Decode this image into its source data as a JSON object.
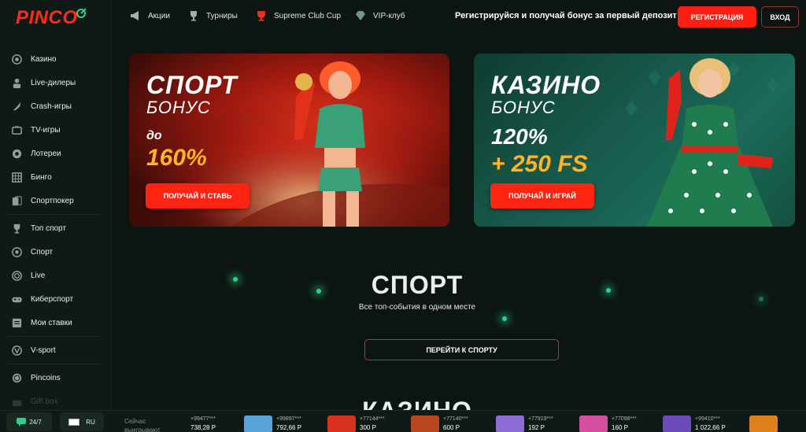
{
  "brand": {
    "name": "PINCO",
    "accent": "#ff2a1a"
  },
  "sidebar": {
    "items": [
      {
        "label": "Казино",
        "icon": "casino-chip-icon"
      },
      {
        "label": "Live-дилеры",
        "icon": "dealer-icon"
      },
      {
        "label": "Crash-игры",
        "icon": "rocket-icon"
      },
      {
        "label": "TV-игры",
        "icon": "tv-icon"
      },
      {
        "label": "Лотереи",
        "icon": "lottery-ball-icon"
      },
      {
        "label": "Бинго",
        "icon": "bingo-icon"
      },
      {
        "label": "Спортпокер",
        "icon": "cards-icon"
      },
      {
        "label": "Топ спорт",
        "icon": "trophy-icon"
      },
      {
        "label": "Спорт",
        "icon": "soccer-ball-icon"
      },
      {
        "label": "Live",
        "icon": "live-icon"
      },
      {
        "label": "Киберспорт",
        "icon": "gamepad-icon"
      },
      {
        "label": "Мои ставки",
        "icon": "bets-icon"
      },
      {
        "label": "V-sport",
        "icon": "vsport-icon"
      },
      {
        "label": "Pincoins",
        "icon": "coin-icon"
      },
      {
        "label": "Gift box",
        "icon": "gift-icon"
      }
    ]
  },
  "topnav": {
    "items": [
      {
        "label": "Акции",
        "icon": "megaphone-icon"
      },
      {
        "label": "Турниры",
        "icon": "trophy-icon"
      },
      {
        "label": "Supreme Club Cup",
        "icon": "cup-icon"
      },
      {
        "label": "VIP-клуб",
        "icon": "diamond-icon"
      }
    ],
    "promo": "Регистрируйся и получай бонус за первый депозит",
    "register_label": "РЕГИСТРАЦИЯ",
    "login_label": "ВХОД"
  },
  "banners": {
    "sport": {
      "title": "СПОРТ",
      "subtitle": "БОНУС",
      "prefix": "до",
      "amount": "160%",
      "button": "ПОЛУЧАЙ И СТАВЬ"
    },
    "casino": {
      "title": "КАЗИНО",
      "subtitle": "БОНУС",
      "line1": "120%",
      "line2": "+ 250 FS",
      "button": "ПОЛУЧАЙ И ИГРАЙ"
    }
  },
  "sport_section": {
    "title": "СПОРТ",
    "subtitle": "Все топ-события в одном месте",
    "button": "ПЕРЕЙТИ К СПОРТУ"
  },
  "casino_section": {
    "title": "КАЗИНО"
  },
  "bottombar": {
    "chat_label": "24/7",
    "lang_label": "RU",
    "now_label": "Сейчас выигрывают",
    "wins": [
      {
        "user": "+99477***",
        "amount": "738,28 Р",
        "thumb_color": "#e7c98a"
      },
      {
        "user": "+99897***",
        "amount": "792,66 Р",
        "thumb_color": "#5aa3d9"
      },
      {
        "user": "+77144***",
        "amount": "300 Р",
        "thumb_color": "#d8321e"
      },
      {
        "user": "+77140***",
        "amount": "600 Р",
        "thumb_color": "#b8461f"
      },
      {
        "user": "+77919***",
        "amount": "192 Р",
        "thumb_color": "#8f6bd6"
      },
      {
        "user": "+77098***",
        "amount": "160 Р",
        "thumb_color": "#d64fa0"
      },
      {
        "user": "+99410***",
        "amount": "1 022,66 Р",
        "thumb_color": "#6d4bbd"
      },
      {
        "user": "",
        "amount": "",
        "thumb_color": "#e0801c"
      }
    ]
  }
}
